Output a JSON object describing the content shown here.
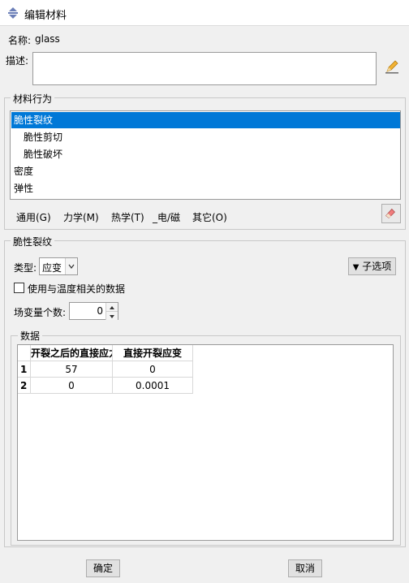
{
  "window": {
    "title": "编辑材料"
  },
  "name_row": {
    "label": "名称:",
    "value": "glass"
  },
  "description": {
    "label": "描述:",
    "value": ""
  },
  "material_behavior": {
    "title": "材料行为",
    "items": [
      {
        "label": "脆性裂纹",
        "indent": 0,
        "selected": true
      },
      {
        "label": "脆性剪切",
        "indent": 1,
        "selected": false
      },
      {
        "label": "脆性破坏",
        "indent": 1,
        "selected": false
      },
      {
        "label": "密度",
        "indent": 0,
        "selected": false
      },
      {
        "label": "弹性",
        "indent": 0,
        "selected": false
      }
    ],
    "menus": [
      "通用(G)",
      "力学(M)",
      "热学(T)",
      "_电/磁",
      "其它(O)"
    ]
  },
  "brittle_cracking": {
    "title": "脆性裂纹",
    "type_label": "类型:",
    "type_value": "应变",
    "suboptions_label": "子选项",
    "temp_checkbox_label": "使用与温度相关的数据",
    "temp_checked": false,
    "field_vars_label": "场变量个数:",
    "field_vars_value": "0"
  },
  "data_table": {
    "title": "数据",
    "columns": [
      "开裂之后的直接应力",
      "直接开裂应变"
    ],
    "rows": [
      {
        "index": "1",
        "cells": [
          "57",
          "0"
        ]
      },
      {
        "index": "2",
        "cells": [
          "0",
          "0.0001"
        ]
      }
    ]
  },
  "footer": {
    "ok_label": "确定",
    "cancel_label": "取消"
  },
  "colors": {
    "selection": "#0078d7",
    "background": "#f0f0f0"
  }
}
